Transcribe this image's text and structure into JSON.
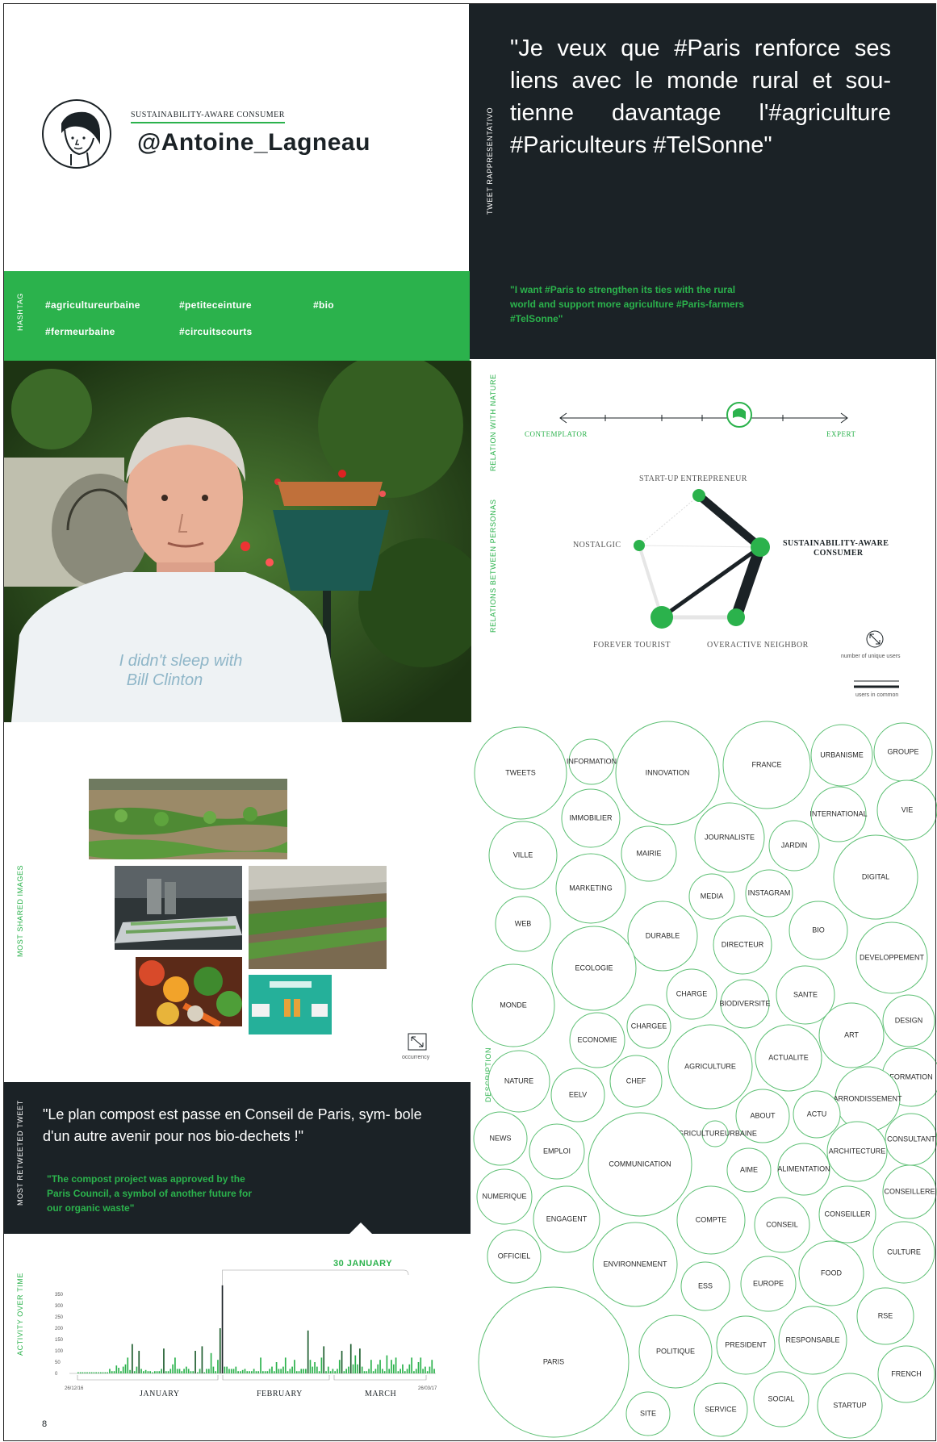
{
  "profile": {
    "role": "SUSTAINABILITY-AWARE CONSUMER",
    "handle": "@Antoine_Lagneau",
    "avatar_icon": "person-face-icon"
  },
  "tweet_repr": {
    "label": "TWEET RAPPRESENTATIVO",
    "text": "\"Je veux que #Paris renforce ses liens avec le monde rural et sou- tienne davantage l'#agriculture #Pariculteurs #TelSonne\"",
    "translation": "\"I want #Paris to strengthen its ties with the rural world and support more agriculture #Paris-farmers #TelSonne\""
  },
  "hashtags": {
    "label": "HASHTAG",
    "items": [
      "#agricultureurbaine",
      "#petiteceinture",
      "#bio",
      "#fermeurbaine",
      "#circuitscourts"
    ]
  },
  "photo": {
    "tshirt_text_1": "I didn't sleep with",
    "tshirt_text_2": "Bill Clinton"
  },
  "nature": {
    "label": "RELATION WITH NATURE",
    "left": "CONTEMPLATOR",
    "right": "EXPERT",
    "position": 0.64
  },
  "personas": {
    "label": "RELATIONS BETWEEN PERSONAS",
    "nodes": [
      "START-UP ENTREPRENEUR",
      "SUSTAINABILITY-AWARE",
      "CONSUMER",
      "NOSTALGIC",
      "FOREVER TOURIST",
      "OVERACTIVE NEIGHBOR"
    ],
    "legend_users": "number of unique users",
    "legend_common": "users in common"
  },
  "images": {
    "label": "MOST SHARED IMAGES",
    "legend": "occurrency"
  },
  "tweet2": {
    "label": "MOST RETWEETED TWEET",
    "text": "\"Le plan compost est passe en Conseil de Paris, sym- bole d'un autre avenir pour nos bio-dechets !\"",
    "translation": "\"The compost project was approved by the Paris Council, a symbol of another future for our organic waste\""
  },
  "activity": {
    "label": "ACTIVITY OVER TIME",
    "peak": "30 JANUARY",
    "start": "26/12/16",
    "end": "26/03/17",
    "months": [
      "JANUARY",
      "FEBRUARY",
      "MARCH"
    ]
  },
  "chart_data": {
    "type": "bar",
    "title": "",
    "xlabel": "",
    "ylabel": "",
    "ylim": [
      0,
      400
    ],
    "yticks": [
      "350",
      "300",
      "250",
      "200",
      "150",
      "100",
      "50",
      "0"
    ],
    "values": [
      5,
      5,
      5,
      5,
      5,
      5,
      5,
      5,
      5,
      5,
      5,
      5,
      5,
      5,
      20,
      10,
      10,
      35,
      25,
      10,
      30,
      40,
      70,
      15,
      130,
      10,
      30,
      100,
      20,
      10,
      15,
      10,
      10,
      5,
      10,
      10,
      10,
      20,
      110,
      10,
      10,
      20,
      40,
      70,
      20,
      20,
      10,
      20,
      30,
      20,
      10,
      10,
      100,
      5,
      20,
      120,
      5,
      20,
      20,
      90,
      30,
      10,
      60,
      200,
      390,
      30,
      30,
      20,
      20,
      20,
      30,
      10,
      10,
      15,
      20,
      10,
      10,
      10,
      20,
      10,
      10,
      70,
      10,
      10,
      10,
      20,
      30,
      10,
      50,
      20,
      20,
      30,
      70,
      10,
      20,
      30,
      60,
      10,
      10,
      20,
      20,
      20,
      190,
      60,
      30,
      50,
      30,
      10,
      70,
      120,
      10,
      30,
      10,
      20,
      10,
      20,
      60,
      100,
      10,
      20,
      30,
      130,
      40,
      80,
      40,
      110,
      30,
      10,
      10,
      20,
      60,
      10,
      20,
      40,
      60,
      20,
      10,
      80,
      20,
      60,
      40,
      70,
      10,
      20,
      40,
      10,
      20,
      40,
      70,
      10,
      20,
      50,
      70,
      20,
      30,
      10,
      30,
      60,
      20
    ]
  },
  "description": {
    "label": "DESCRIPTION",
    "words": [
      "TWEETS",
      "INFORMATION",
      "INNOVATION",
      "FRANCE",
      "URBANISME",
      "GROUPE",
      "IMMOBILIER",
      "INTERNATIONAL",
      "VIE",
      "VILLE",
      "MAIRIE",
      "JOURNALISTE",
      "JARDIN",
      "DIGITAL",
      "MARKETING",
      "MEDIA",
      "INSTAGRAM",
      "WEB",
      "DURABLE",
      "DIRECTEUR",
      "BIO",
      "DEVELOPPEMENT",
      "ECOLOGIE",
      "CHARGE",
      "SANTE",
      "MONDE",
      "BIODIVERSITE",
      "DESIGN",
      "CHARGEE",
      "ART",
      "ECONOMIE",
      "ACTUALITE",
      "AGRICULTURE",
      "FORMATION",
      "NATURE",
      "EELV",
      "CHEF",
      "ARRONDISSEMENT",
      "ABOUT",
      "ACTU",
      "AGRICULTUREURBAINE",
      "NEWS",
      "EMPLOI",
      "CONSULTANT",
      "ARCHITECTURE",
      "COMMUNICATION",
      "AIME",
      "ALIMENTATION",
      "NUMERIQUE",
      "CONSEILLERE",
      "ENGAGENT",
      "COMPTE",
      "CONSEIL",
      "CONSEILLER",
      "OFFICIEL",
      "CULTURE",
      "ENVIRONNEMENT",
      "FOOD",
      "ESS",
      "EUROPE",
      "RSE",
      "PARIS",
      "POLITIQUE",
      "PRESIDENT",
      "RESPONSABLE",
      "FRENCH",
      "SITE",
      "SERVICE",
      "SOCIAL",
      "STARTUP"
    ]
  },
  "page_number": "8",
  "colors": {
    "dark": "#1b2226",
    "green": "#2bb24c",
    "bubble": "#5cbf73"
  }
}
